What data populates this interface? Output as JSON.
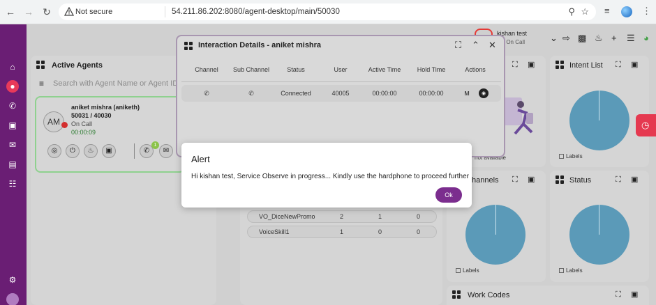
{
  "browser": {
    "security_label": "Not secure",
    "url": "54.211.86.202:8080/agent-desktop/main/50030"
  },
  "header": {
    "user_name": "kishan test",
    "user_status": "ult- On Call"
  },
  "active_agents": {
    "title": "Active Agents",
    "search_placeholder": "Search with Agent Name or Agent ID",
    "agent": {
      "initials": "AM",
      "name": "aniket mishra (aniketh)",
      "ext": "50031 / 40030",
      "status": "On Call",
      "timer": "00:00:09",
      "badge_count": "1"
    }
  },
  "interaction": {
    "title": "Interaction Details - aniket mishra",
    "headers": [
      "Channel",
      "Sub Channel",
      "Status",
      "User",
      "Active Time",
      "Hold Time",
      "Actions"
    ],
    "row": {
      "status": "Connected",
      "user": "40005",
      "active_time": "00:00:00",
      "hold_time": "00:00:00"
    }
  },
  "skills": [
    {
      "name": "VO_DiceNewPromo",
      "a": "2",
      "b": "1",
      "c": "0"
    },
    {
      "name": "VoiceSkill1",
      "a": "1",
      "b": "0",
      "c": "0"
    }
  ],
  "panels": {
    "intent_list": "Intent List",
    "channels": "hannels",
    "status": "Status",
    "work_codes": "Work Codes",
    "labels": "Labels",
    "empty_caption": "not available"
  },
  "alert": {
    "title": "Alert",
    "message": "Hi kishan test, Service Observe in progress... Kindly use the hardphone to proceed further",
    "ok_label": "Ok"
  },
  "colors": {
    "brand": "#6a1e74",
    "accent_red": "#e53950",
    "pie": "#5b9ab8"
  }
}
